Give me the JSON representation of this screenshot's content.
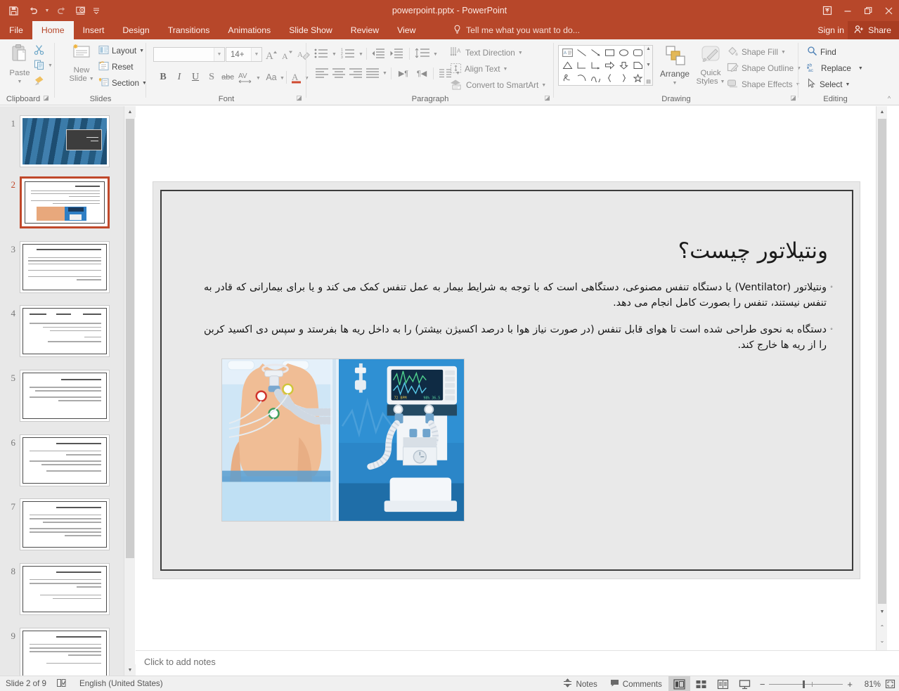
{
  "window": {
    "title": "powerpoint.pptx - PowerPoint",
    "accent_color": "#b7472a",
    "share_bg": "#a93d22"
  },
  "quick_access": [
    {
      "name": "save-icon",
      "label": "Save"
    },
    {
      "name": "undo-icon",
      "label": "Undo"
    },
    {
      "name": "redo-icon",
      "label": "Redo"
    },
    {
      "name": "start-presentation-icon",
      "label": "Start From Beginning"
    },
    {
      "name": "customize-qat-icon",
      "label": "Customize Quick Access Toolbar"
    }
  ],
  "window_controls": [
    {
      "name": "ribbon-display-options-icon",
      "glyph": "⤒"
    },
    {
      "name": "minimize-icon",
      "glyph": "–"
    },
    {
      "name": "restore-icon",
      "glyph": "❐"
    },
    {
      "name": "close-icon",
      "glyph": "✕"
    }
  ],
  "tabs": [
    {
      "label": "File",
      "active": false
    },
    {
      "label": "Home",
      "active": true
    },
    {
      "label": "Insert",
      "active": false
    },
    {
      "label": "Design",
      "active": false
    },
    {
      "label": "Transitions",
      "active": false
    },
    {
      "label": "Animations",
      "active": false
    },
    {
      "label": "Slide Show",
      "active": false
    },
    {
      "label": "Review",
      "active": false
    },
    {
      "label": "View",
      "active": false
    }
  ],
  "tellme": {
    "placeholder": "Tell me what you want to do..."
  },
  "account": {
    "sign_in": "Sign in",
    "share": "Share"
  },
  "ribbon": {
    "clipboard": {
      "label": "Clipboard",
      "paste": "Paste",
      "cut": "Cut",
      "copy": "Copy",
      "format_painter": "Format Painter"
    },
    "slides": {
      "label": "Slides",
      "new_slide": "New\nSlide",
      "new_slide_line1": "New",
      "new_slide_line2": "Slide",
      "layout": "Layout",
      "reset": "Reset",
      "section": "Section"
    },
    "font": {
      "label": "Font",
      "font_name_value": "",
      "font_size_value": "14+",
      "increase_font": "Increase Font Size",
      "decrease_font": "Decrease Font Size",
      "clear_formatting": "Clear All Formatting",
      "bold": "B",
      "italic": "I",
      "underline": "U",
      "shadow": "S",
      "strikethrough": "abc",
      "character_spacing": "AV",
      "change_case": "Aa",
      "font_color": "A"
    },
    "paragraph": {
      "label": "Paragraph",
      "text_direction": "Text Direction",
      "align_text": "Align Text",
      "convert_to_smartart": "Convert to SmartArt"
    },
    "drawing": {
      "label": "Drawing",
      "arrange": "Arrange",
      "quick_styles_line1": "Quick",
      "quick_styles_line2": "Styles",
      "shape_fill": "Shape Fill",
      "shape_outline": "Shape Outline",
      "shape_effects": "Shape Effects"
    },
    "editing": {
      "label": "Editing",
      "find": "Find",
      "replace": "Replace",
      "select": "Select"
    },
    "collapse": "Collapse the Ribbon"
  },
  "slides_panel": {
    "slides": [
      {
        "number": "1",
        "selected": false,
        "kind": "title"
      },
      {
        "number": "2",
        "selected": true,
        "kind": "ventilator"
      },
      {
        "number": "3",
        "selected": false,
        "kind": "text"
      },
      {
        "number": "4",
        "selected": false,
        "kind": "text"
      },
      {
        "number": "5",
        "selected": false,
        "kind": "text"
      },
      {
        "number": "6",
        "selected": false,
        "kind": "text"
      },
      {
        "number": "7",
        "selected": false,
        "kind": "text"
      },
      {
        "number": "8",
        "selected": false,
        "kind": "text"
      },
      {
        "number": "9",
        "selected": false,
        "kind": "text"
      }
    ]
  },
  "slide": {
    "title": "ونتیلاتور چیست؟",
    "bullets": [
      {
        "marker": "◦",
        "text": "ونتیلاتور (Ventilator) یا دستگاه تنفس مصنوعی، دستگاهی است که با توجه به شرایط بیمار به عمل تنفس کمک می کند و یا برای بیمارانی که قادر به تنفس نیستند، تنفس را بصورت کامل انجام می دهد."
      },
      {
        "marker": "◦",
        "text": "دستگاه به نحوی طراحی شده است تا هوای قابل تنفس (در صورت نیاز هوا با درصد اکسیژن بیشتر) را به داخل ریه ها بفرستد و سپس دی اکسید کربن را از ریه ها خارج کند."
      }
    ],
    "image_alt": "ventilator-illustration"
  },
  "notes": {
    "placeholder": "Click to add notes"
  },
  "status_bar": {
    "slide_indicator": "Slide 2 of 9",
    "language": "English (United States)",
    "notes": "Notes",
    "comments": "Comments",
    "zoom_percent": "81%",
    "views": [
      {
        "name": "normal-view",
        "active": true
      },
      {
        "name": "slide-sorter-view",
        "active": false
      },
      {
        "name": "reading-view",
        "active": false
      },
      {
        "name": "slide-show-view",
        "active": false
      }
    ],
    "zoom_out": "−",
    "zoom_in": "+",
    "fit_slide": "Fit slide to current window"
  }
}
